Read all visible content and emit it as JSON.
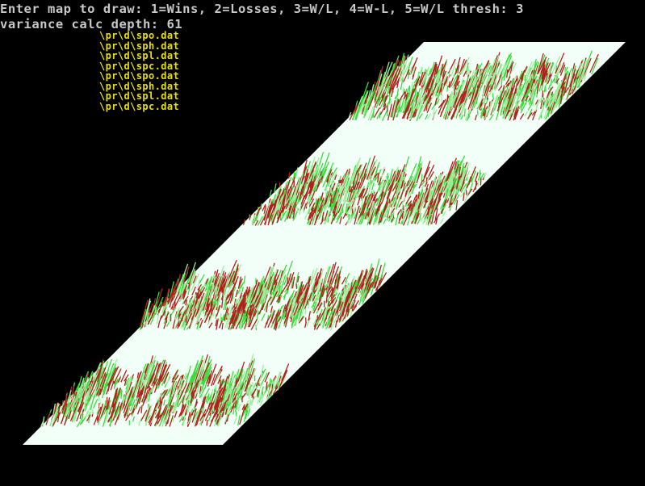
{
  "console": {
    "prompt": "Enter map to draw: 1=Wins, 2=Losses, 3=W/L, 4=W-L, 5=W/L thresh: 3",
    "variance_label": "variance calc depth: 61"
  },
  "files": [
    "\\pr\\d\\spo.dat",
    "\\pr\\d\\sph.dat",
    "\\pr\\d\\spl.dat",
    "\\pr\\d\\spc.dat",
    "\\pr\\d\\spo.dat",
    "\\pr\\d\\sph.dat",
    "\\pr\\d\\spl.dat",
    "\\pr\\d\\spc.dat"
  ],
  "colors": {
    "background": "#000000",
    "console_text": "#c8c8c8",
    "file_text": "#e8e000",
    "plane": "#f2fff8",
    "win_color": "#3cdc3c",
    "loss_color": "#b41e1e",
    "light_green": "#9cf09c"
  }
}
